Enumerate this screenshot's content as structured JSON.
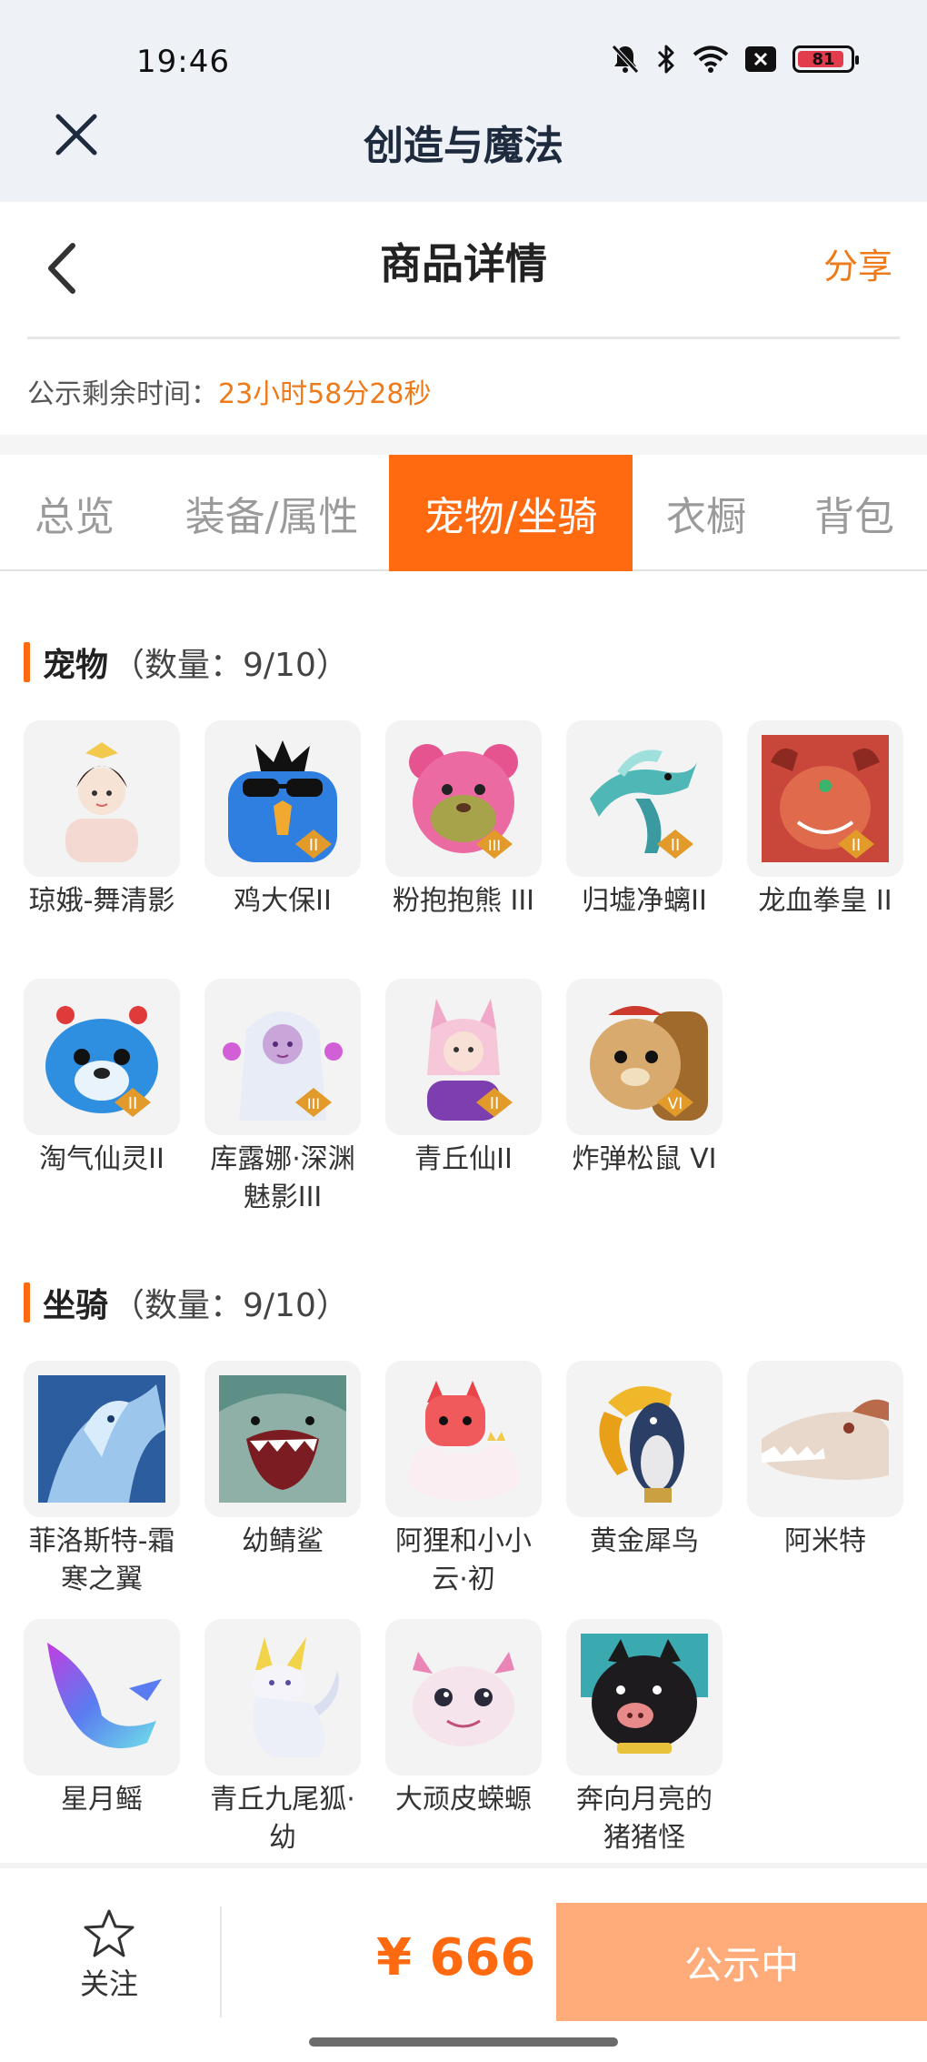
{
  "status_bar": {
    "time": "19:46",
    "battery": "81"
  },
  "app_bar": {
    "title": "创造与魔法"
  },
  "header": {
    "title": "商品详情",
    "share": "分享"
  },
  "notice": {
    "label": "公示剩余时间：",
    "value": "23小时58分28秒"
  },
  "tabs": [
    {
      "label": "总览"
    },
    {
      "label": "装备/属性"
    },
    {
      "label": "宠物/坐骑"
    },
    {
      "label": "衣橱"
    },
    {
      "label": "背包"
    }
  ],
  "active_tab": "宠物/坐骑",
  "pets": {
    "title": "宠物",
    "count": "（数量：9/10）",
    "items": [
      {
        "name": "琼娥-舞清影",
        "icon": "pet-fairy-icon"
      },
      {
        "name": "鸡大保II",
        "icon": "pet-bird-icon"
      },
      {
        "name": "粉抱抱熊 III",
        "icon": "pet-bear-icon"
      },
      {
        "name": "归墟净螭II",
        "icon": "pet-dragon-icon"
      },
      {
        "name": "龙血拳皇 II",
        "icon": "pet-beast-icon"
      },
      {
        "name": "淘气仙灵II",
        "icon": "pet-sprite-icon"
      },
      {
        "name": "库露娜·深渊魅影III",
        "icon": "pet-witch-icon"
      },
      {
        "name": "青丘仙II",
        "icon": "pet-fox-girl-icon"
      },
      {
        "name": "炸弹松鼠 VI",
        "icon": "pet-squirrel-icon"
      }
    ]
  },
  "mounts": {
    "title": "坐骑",
    "count": "（数量：9/10）",
    "items": [
      {
        "name": "菲洛斯特-霜寒之翼",
        "icon": "mount-ice-dragon-icon"
      },
      {
        "name": "幼鲭鲨",
        "icon": "mount-shark-icon"
      },
      {
        "name": "阿狸和小小云·初",
        "icon": "mount-fox-cloud-icon"
      },
      {
        "name": "黄金犀鸟",
        "icon": "mount-hornbill-icon"
      },
      {
        "name": "阿米特",
        "icon": "mount-crocodile-icon"
      },
      {
        "name": "星月鳐",
        "icon": "mount-ray-icon"
      },
      {
        "name": "青丘九尾狐·幼",
        "icon": "mount-ninetail-icon"
      },
      {
        "name": "大顽皮蝾螈",
        "icon": "mount-axolotl-icon"
      },
      {
        "name": "奔向月亮的猪猪怪",
        "icon": "mount-pig-icon"
      }
    ]
  },
  "bottom": {
    "follow": "关注",
    "price": "¥ 666",
    "status_button": "公示中"
  },
  "colors": {
    "accent": "#ff6a10",
    "accent_light": "#ffab7a",
    "timer": "#ef7a1a"
  }
}
